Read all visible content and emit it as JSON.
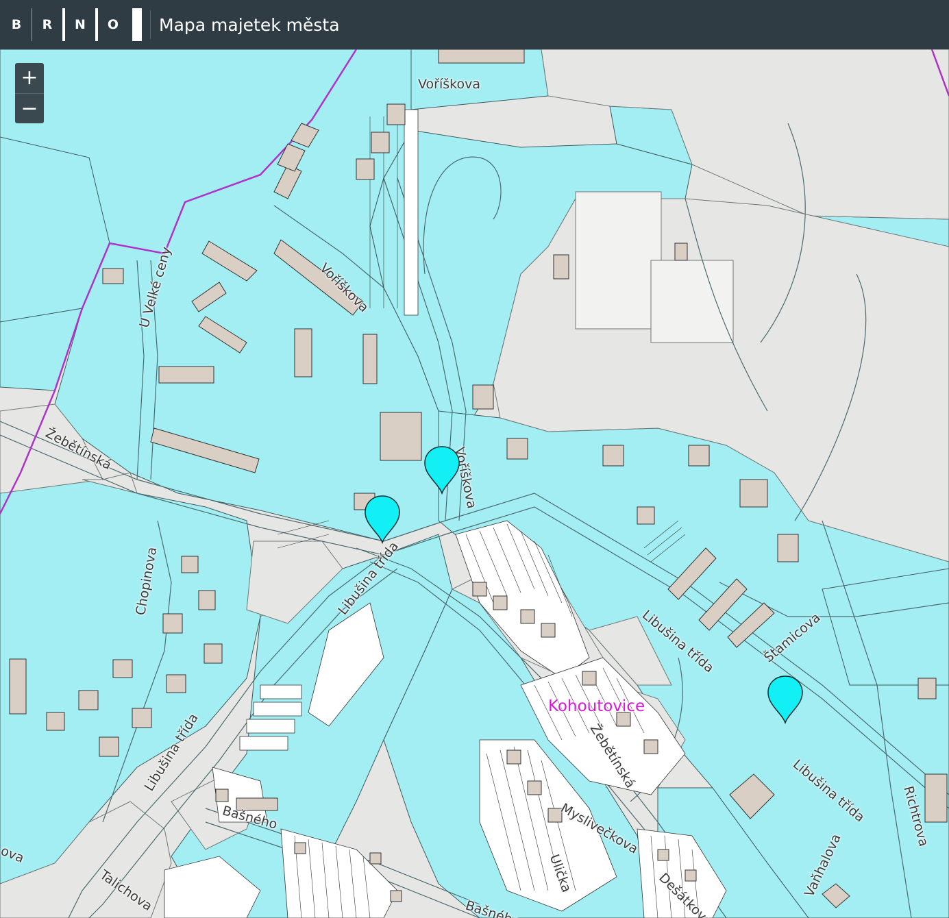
{
  "header": {
    "logo_letters": [
      "B",
      "R",
      "N",
      "O"
    ],
    "title": "Mapa majetek města"
  },
  "zoom": {
    "in_label": "+",
    "out_label": "−"
  },
  "colors": {
    "owned_parcel": "#a3eef3",
    "other_parcel": "#e6e6e4",
    "building": "#d9cfc4",
    "boundary": "#b031c9",
    "marker": "#13f0f5",
    "header": "#2f3c44"
  },
  "map": {
    "district": "Kohoutovice",
    "streets": [
      "Voříškova",
      "U Velké ceny",
      "Voříškova",
      "Žebětínská",
      "Voříškova",
      "Chopinova",
      "Libušina třída",
      "Libušina třída",
      "Štamicova",
      "Libušina třída",
      "Žebětínská",
      "Libušina třída",
      "Richtrova",
      "Bašného",
      "Myslivečkova",
      "Ulička",
      "Dešátkova",
      "Vaňhalova",
      "Talichova",
      "Bašného",
      "ova"
    ],
    "markers": [
      {
        "name": "property-marker"
      },
      {
        "name": "property-marker"
      },
      {
        "name": "property-marker"
      }
    ]
  }
}
